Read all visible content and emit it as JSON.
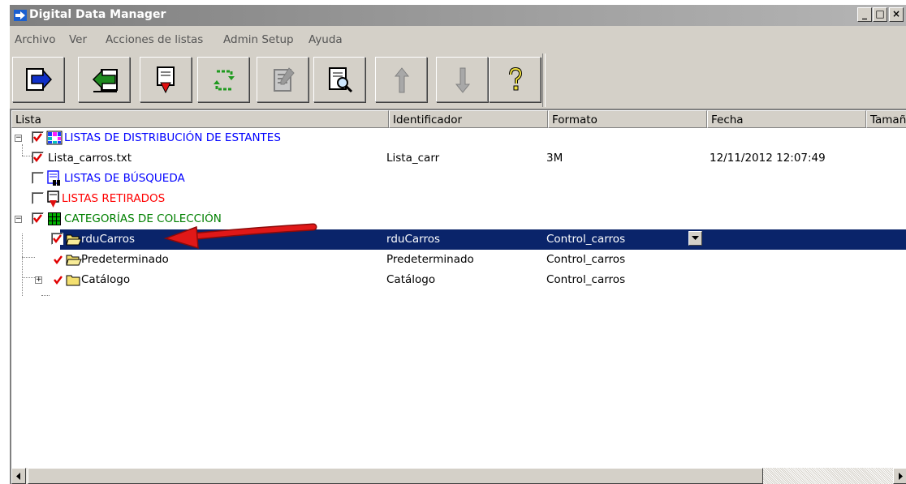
{
  "window": {
    "title": "Digital Data Manager"
  },
  "title_controls": {
    "minimize": "_",
    "maximize": "□",
    "close": "×"
  },
  "menu": [
    "Archivo",
    "Ver",
    "Acciones de listas",
    "Admin Setup",
    "Ayuda"
  ],
  "toolbar": [
    {
      "icon": "import-arrow-icon"
    },
    {
      "icon": "export-arrow-icon"
    },
    {
      "icon": "retire-document-icon"
    },
    {
      "icon": "refresh-cycle-icon"
    },
    {
      "icon": "notepad-icon"
    },
    {
      "icon": "search-document-icon"
    },
    {
      "icon": "move-up-icon"
    },
    {
      "icon": "move-down-icon"
    },
    {
      "icon": "help-icon"
    }
  ],
  "columns": [
    "Lista",
    "Identificador",
    "Formato",
    "Fecha",
    "Tamaño"
  ],
  "rows": [
    {
      "label": "LISTAS DE DISTRIBUCIÓN DE ESTANTES",
      "label_color": "#0000ff",
      "id": "",
      "format": "",
      "date": "",
      "icon": "shelf-list-icon",
      "checked": true
    },
    {
      "label": "Lista_carros.txt",
      "label_color": "#000000",
      "id": "Lista_carr",
      "format": "3M",
      "date": "12/11/2012 12:07:49",
      "icon": "",
      "checked": true
    },
    {
      "label": "LISTAS DE BÚSQUEDA",
      "label_color": "#0000ff",
      "id": "",
      "format": "",
      "date": "",
      "icon": "search-list-icon",
      "checked": false
    },
    {
      "label": "LISTAS RETIRADOS",
      "label_color": "#ff0000",
      "id": "",
      "format": "",
      "date": "",
      "icon": "retired-list-icon",
      "checked": false
    },
    {
      "label": "CATEGORÍAS DE COLECCIÓN",
      "label_color": "#008000",
      "id": "",
      "format": "",
      "date": "",
      "icon": "collection-grid-icon",
      "checked": true
    },
    {
      "label": "rduCarros",
      "label_color": "#ffffff",
      "id": "rduCarros",
      "format": "Control_carros",
      "date": "",
      "icon": "folder-open-icon",
      "checked": true,
      "selected": true
    },
    {
      "label": "Predeterminado",
      "label_color": "#000000",
      "id": "Predeterminado",
      "format": "Control_carros",
      "date": "",
      "icon": "folder-open-icon",
      "checked": true
    },
    {
      "label": "Catálogo",
      "label_color": "#000000",
      "id": "Catálogo",
      "format": "Control_carros",
      "date": "",
      "icon": "folder-icon",
      "checked": true
    }
  ],
  "colors": {
    "selection": "#0a246a",
    "check": "#e00000",
    "annotation_arrow": "#e01818"
  }
}
